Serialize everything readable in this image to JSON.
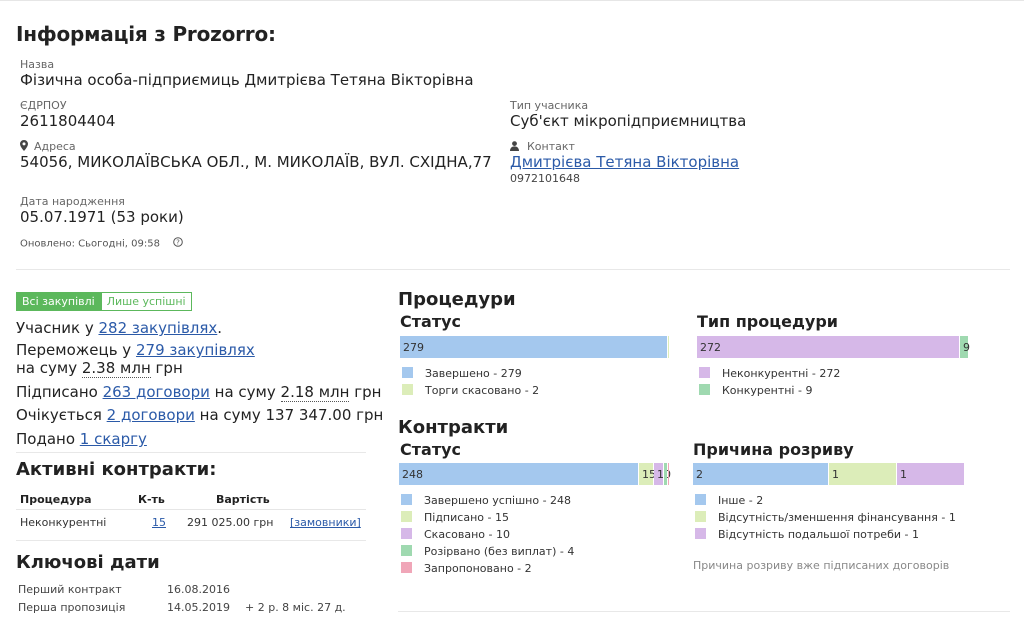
{
  "title": "Інформація з Prozorro:",
  "name_label": "Назва",
  "name_value": "Фізична особа-підприємиць Дмитрієва Тетяна Вікторівна",
  "edrpou_label": "ЄДРПОУ",
  "edrpou_value": "2611804404",
  "participant_type_label": "Тип учасника",
  "participant_type_value": "Суб'єкт мікропідприємництва",
  "address_label": "Адреса",
  "address_value": "54056, МИКОЛАЇВСЬКА ОБЛ., М. МИКОЛАЇВ, ВУЛ. СХІДНА,77",
  "contact_label": "Контакт",
  "contact_name": "Дмитрієва Тетяна Вікторівна",
  "contact_phone": "0972101648",
  "birth_label": "Дата народження",
  "birth_value": "05.07.1971 (53 роки)",
  "updated": "Оновлено: Сьогодні, 09:58",
  "filter": {
    "all": "Всі закупівлі",
    "success": "Лише успішні"
  },
  "stats": {
    "participant_prefix": "Учасник у",
    "participant_link": "282 закупівлях",
    "participant_suffix": ".",
    "winner_prefix": "Переможець у",
    "winner_link": "279 закупівлях",
    "winner_sum_prefix": "на суму",
    "winner_sum": "2.38 млн",
    "winner_sum_suffix": "грн",
    "signed_prefix": "Підписано",
    "signed_link": "263 договори",
    "signed_mid": "на суму",
    "signed_sum": "2.18 млн",
    "signed_suffix": "грн",
    "expected_prefix": "Очікується",
    "expected_link": "2 договори",
    "expected_suffix": "на суму 137 347.00 грн",
    "complaint_prefix": "Подано",
    "complaint_link": "1 скаргу"
  },
  "active_contracts": {
    "title": "Активні контракти:",
    "headers": [
      "Процедура",
      "К-ть",
      "Вартість"
    ],
    "row": {
      "procedure": "Неконкурентні",
      "count": "15",
      "value": "291 025.00 грн",
      "link": "[замовники]"
    }
  },
  "key_dates": {
    "title": "Ключові дати",
    "first_contract_label": "Перший контракт",
    "first_contract_date": "16.08.2016",
    "first_offer_label": "Перша пропозиція",
    "first_offer_date": "14.05.2019",
    "first_offer_delta": "+ 2 р. 8 міс. 27 д."
  },
  "procedures": {
    "title": "Процедури",
    "status_title": "Статус",
    "type_title": "Тип процедури"
  },
  "contracts": {
    "title": "Контракти",
    "status_title": "Статус",
    "reason_title": "Причина розриву",
    "note": "Причина розриву вже підписаних договорів"
  },
  "colors": {
    "blue": "#a4c8ee",
    "lightgreen": "#dcedb9",
    "purple": "#d6b8e8",
    "green": "#9fd9b0",
    "pink": "#f0a6b8",
    "link": "#2b5aa8",
    "tab_green": "#5cb85c"
  },
  "chart_data": [
    {
      "type": "bar",
      "title": "Статус",
      "series": [
        {
          "name": "Завершено",
          "values": [
            279
          ],
          "color": "#a4c8ee",
          "legend": "Завершено - 279"
        },
        {
          "name": "Торги скасовано",
          "values": [
            2
          ],
          "color": "#dcedb9",
          "legend": "Торги скасовано - 2"
        }
      ],
      "bar_labels": [
        "279",
        ""
      ]
    },
    {
      "type": "bar",
      "title": "Тип процедури",
      "series": [
        {
          "name": "Неконкурентні",
          "values": [
            272
          ],
          "color": "#d6b8e8",
          "legend": "Неконкурентні - 272"
        },
        {
          "name": "Конкурентні",
          "values": [
            9
          ],
          "color": "#9fd9b0",
          "legend": "Конкурентні - 9"
        }
      ],
      "bar_labels": [
        "272",
        "9"
      ]
    },
    {
      "type": "bar",
      "title": "Статус",
      "series": [
        {
          "name": "Завершено успішно",
          "values": [
            248
          ],
          "color": "#a4c8ee",
          "legend": "Завершено успішно - 248"
        },
        {
          "name": "Підписано",
          "values": [
            15
          ],
          "color": "#dcedb9",
          "legend": "Підписано - 15"
        },
        {
          "name": "Скасовано",
          "values": [
            10
          ],
          "color": "#d6b8e8",
          "legend": "Скасовано - 10"
        },
        {
          "name": "Розірвано (без виплат)",
          "values": [
            4
          ],
          "color": "#9fd9b0",
          "legend": "Розірвано (без виплат) - 4"
        },
        {
          "name": "Запропоновано",
          "values": [
            2
          ],
          "color": "#f0a6b8",
          "legend": "Запропоновано - 2"
        }
      ],
      "bar_labels": [
        "248",
        "15",
        "10",
        "",
        ""
      ]
    },
    {
      "type": "bar",
      "title": "Причина розриву",
      "series": [
        {
          "name": "Інше",
          "values": [
            2
          ],
          "color": "#a4c8ee",
          "legend": "Інше - 2"
        },
        {
          "name": "Відсутність/зменшення фінансування",
          "values": [
            1
          ],
          "color": "#dcedb9",
          "legend": "Відсутність/зменшення фінансування - 1"
        },
        {
          "name": "Відсутність подальшої потреби",
          "values": [
            1
          ],
          "color": "#d6b8e8",
          "legend": "Відсутність подальшої потреби - 1"
        }
      ],
      "bar_labels": [
        "2",
        "1",
        "1"
      ]
    }
  ]
}
